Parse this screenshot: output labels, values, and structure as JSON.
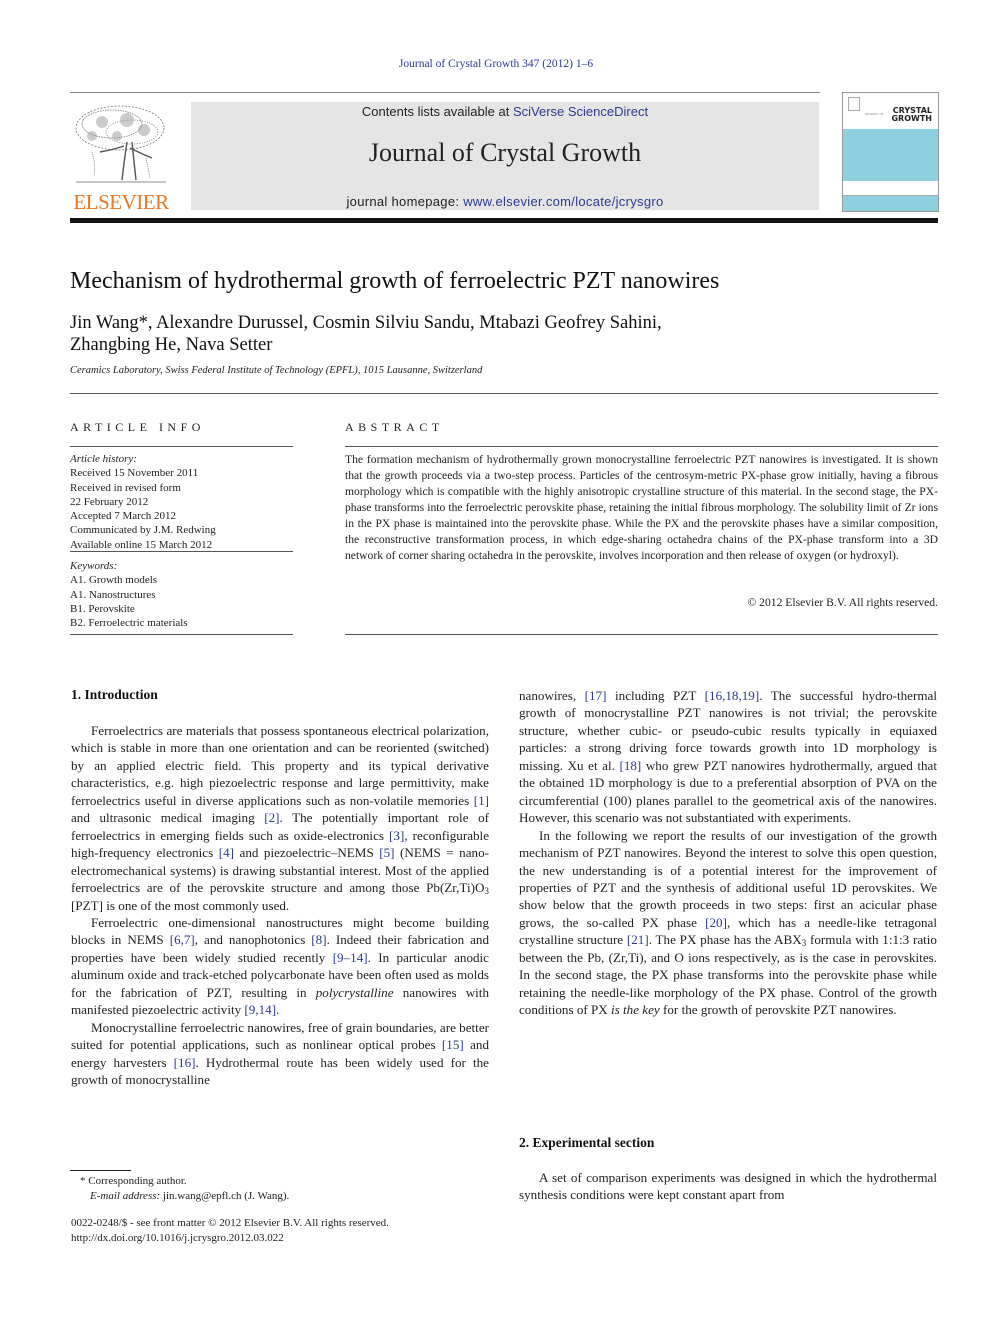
{
  "running_head": "Journal of Crystal Growth 347 (2012) 1–6",
  "header": {
    "publisher_logo_text": "ELSEVIER",
    "contents_prefix": "Contents lists available at ",
    "contents_link": "SciVerse ScienceDirect",
    "journal_title": "Journal of Crystal Growth",
    "homepage_prefix": "journal homepage: ",
    "homepage_link": "www.elsevier.com/locate/jcrysgro",
    "cover_line1": "CRYSTAL",
    "cover_line2": "GROWTH",
    "cover_small": "JOURNAL OF",
    "colors": {
      "brand_orange": "#e87722",
      "link_blue": "#2a3b8f",
      "cover_cyan": "#8ed0df",
      "banner_gray": "#e5e5e5"
    }
  },
  "article": {
    "title": "Mechanism of hydrothermal growth of ferroelectric PZT nanowires",
    "authors_line1": "Jin Wang*, Alexandre Durussel, Cosmin Silviu Sandu, Mtabazi Geofrey Sahini,",
    "authors_line2": "Zhangbing He, Nava Setter",
    "affiliation": "Ceramics Laboratory, Swiss Federal Institute of Technology (EPFL), 1015 Lausanne, Switzerland"
  },
  "article_info": {
    "heading": "ARTICLE INFO",
    "history_label": "Article history:",
    "history": [
      "Received 15 November 2011",
      "Received in revised form",
      "22 February 2012",
      "Accepted 7 March 2012",
      "Communicated by J.M. Redwing",
      "Available online 15 March 2012"
    ],
    "keywords_label": "Keywords:",
    "keywords": [
      "A1. Growth models",
      "A1. Nanostructures",
      "B1. Perovskite",
      "B2. Ferroelectric materials"
    ]
  },
  "abstract": {
    "heading": "ABSTRACT",
    "text": "The formation mechanism of hydrothermally grown monocrystalline ferroelectric PZT nanowires is investigated. It is shown that the growth proceeds via a two-step process. Particles of the centrosym-metric PX-phase grow initially, having a fibrous morphology which is compatible with the highly anisotropic crystalline structure of this material. In the second stage, the PX-phase transforms into the ferroelectric perovskite phase, retaining the initial fibrous morphology. The solubility limit of Zr ions in the PX phase is maintained into the perovskite phase. While the PX and the perovskite phases have a similar composition, the reconstructive transformation process, in which edge-sharing octahedra chains of the PX-phase transform into a 3D network of corner sharing octahedra in the perovskite, involves incorporation and then release of oxygen (or hydroxyl).",
    "copyright": "© 2012 Elsevier B.V. All rights reserved."
  },
  "sections": {
    "intro_heading": "1.  Introduction",
    "intro": {
      "p1_a": "Ferroelectrics are materials that possess spontaneous electrical polarization, which is stable in more than one orientation and can be reoriented (switched) by an applied electric field. This property and its typical derivative characteristics, e.g. high piezoelectric response and large permittivity, make ferroelectrics useful in diverse applications such as non-volatile memories ",
      "ref1": "[1]",
      "p1_b": " and ultrasonic medical imaging ",
      "ref2": "[2]",
      "p1_c": ". The potentially important role of ferroelectrics in emerging fields such as oxide-electronics ",
      "ref3": "[3]",
      "p1_d": ", reconfigurable high-frequency electronics ",
      "ref4": "[4]",
      "p1_e": " and piezoelectric–NEMS ",
      "ref5": "[5]",
      "p1_f": " (NEMS = nano-electromechanical systems) is drawing substantial interest. Most of the applied ferroelectrics are of the perovskite structure and among those Pb(Zr,Ti)O",
      "p1_sub": "3",
      "p1_g": " [PZT] is one of the most commonly used.",
      "p2_a": "Ferroelectric one-dimensional nanostructures might become building blocks in NEMS ",
      "ref67": "[6,7]",
      "p2_b": ", and nanophotonics ",
      "ref8": "[8]",
      "p2_c": ". Indeed their fabrication and properties have been widely studied recently ",
      "ref914": "[9–14]",
      "p2_d": ". In particular anodic aluminum oxide and track-etched polycarbonate have been often used as molds for the fabrication of PZT, resulting in ",
      "p2_em": "polycrystalline",
      "p2_e": " nanowires with manifested piezoelectric activity ",
      "ref9_14": "[9,14]",
      "p2_f": ".",
      "p3_a": "Monocrystalline ferroelectric nanowires, free of grain boundaries, are better suited for potential applications, such as nonlinear optical probes ",
      "ref15": "[15]",
      "p3_b": " and energy harvesters ",
      "ref16": "[16]",
      "p3_c": ". Hydrothermal route has been widely used for the growth of monocrystalline",
      "p3_d": "nanowires, ",
      "ref17": "[17]",
      "p3_e": " including PZT ",
      "ref161819": "[16,18,19]",
      "p3_f": ". The successful hydro-thermal growth of monocrystalline PZT nanowires is not trivial; the perovskite structure, whether cubic- or pseudo-cubic results typically in equiaxed particles: a strong driving force towards growth into 1D morphology is missing. Xu et al. ",
      "ref18": "[18]",
      "p3_g": " who grew PZT nanowires hydrothermally, argued that the obtained 1D morphology is due to a preferential absorption of PVA on the circumferential (100) planes parallel to the geometrical axis of the nanowires. However, this scenario was not substantiated with experiments.",
      "p4_a": "In the following we report the results of our investigation of the growth mechanism of PZT nanowires. Beyond the interest to solve this open question, the new understanding is of a potential interest for the improvement of properties of PZT and the synthesis of additional useful 1D perovskites. We show below that the growth proceeds in two steps: first an acicular phase grows, the so-called PX phase ",
      "ref20": "[20]",
      "p4_b": ", which has a needle-like tetragonal crystalline structure ",
      "ref21": "[21]",
      "p4_c": ". The PX phase has the ABX",
      "p4_sub": "3",
      "p4_d": " formula with 1:1:3 ratio between the Pb, (Zr,Ti), and O ions respectively, as is the case in perovskites. In the second stage, the PX phase transforms into the perovskite phase while retaining the needle-like morphology of the PX phase. Control of the growth conditions of PX ",
      "p4_em": "is the key",
      "p4_e": " for the growth of perovskite PZT nanowires."
    },
    "exp_heading": "2.  Experimental section",
    "exp_p1": "A set of comparison experiments was designed in which the hydrothermal synthesis conditions were kept constant apart from"
  },
  "footnote": {
    "corresponding": "* Corresponding author.",
    "email_label": "E-mail address:",
    "email": " jin.wang@epfl.ch (J. Wang)."
  },
  "front_matter": {
    "issn_line": "0022-0248/$ - see front matter © 2012 Elsevier B.V. All rights reserved.",
    "doi": "http://dx.doi.org/10.1016/j.jcrysgro.2012.03.022"
  }
}
